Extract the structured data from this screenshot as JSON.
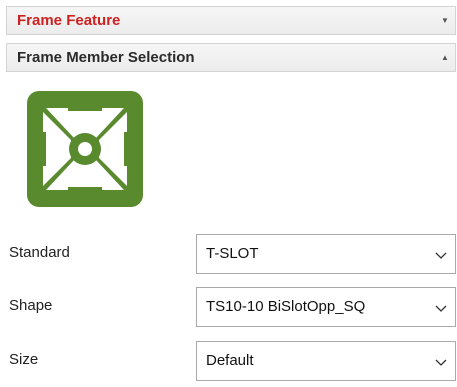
{
  "frame_feature": {
    "title": "Frame Feature",
    "collapse_icon": "chevron-down-icon",
    "title_color": "#cc2222"
  },
  "member_selection": {
    "title": "Frame Member Selection",
    "collapse_icon": "chevron-up-icon",
    "profile_icon": "tslot-profile-icon",
    "profile_color": "#5a8a2e",
    "fields": {
      "standard": {
        "label": "Standard",
        "value": "T-SLOT"
      },
      "shape": {
        "label": "Shape",
        "value": "TS10-10 BiSlotOpp_SQ"
      },
      "size": {
        "label": "Size",
        "value": "Default"
      }
    }
  }
}
